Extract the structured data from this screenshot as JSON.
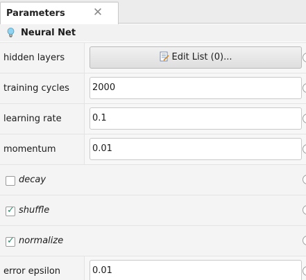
{
  "tab": {
    "title": "Parameters",
    "close_glyph": "✕",
    "close_icon": "close-icon"
  },
  "operator": {
    "name": "Neural Net",
    "icon": "lightbulb-icon"
  },
  "parameters": {
    "hidden_layers": {
      "label": "hidden layers",
      "button_label": "Edit List (0)...",
      "button_icon": "edit-list-icon"
    },
    "training_cycles": {
      "label": "training cycles",
      "value": "2000"
    },
    "learning_rate": {
      "label": "learning rate",
      "value": "0.1"
    },
    "momentum": {
      "label": "momentum",
      "value": "0.01"
    },
    "decay": {
      "label": "decay",
      "checked": false
    },
    "shuffle": {
      "label": "shuffle",
      "checked": true
    },
    "normalize": {
      "label": "normalize",
      "checked": true
    },
    "error_epsilon": {
      "label": "error epsilon",
      "value": "0.01"
    }
  },
  "check_glyph": "✓",
  "colors": {
    "check": "#2a8c6e",
    "bulb": "#8fd3f0"
  }
}
